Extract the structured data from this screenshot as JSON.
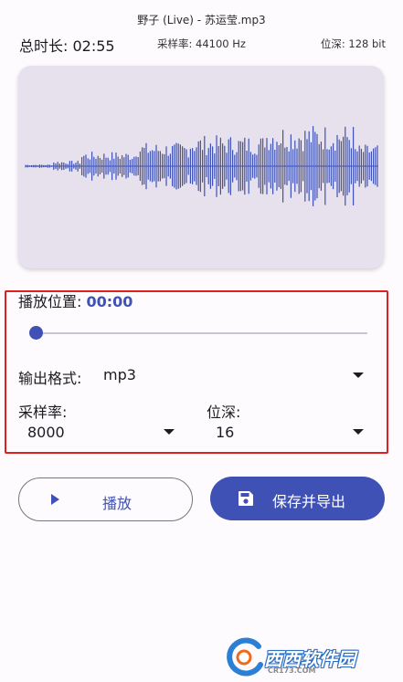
{
  "header": {
    "file_title": "野子 (Live) - 苏运莹.mp3",
    "duration": "总时长: 02:55",
    "sample_rate_info": "采样率: 44100 Hz",
    "bit_depth_info": "位深: 128 bit"
  },
  "waveform": {
    "color": "#3f51b5",
    "background": "#e6e1ec"
  },
  "controls": {
    "position_label": "播放位置: ",
    "position_value": "00:00",
    "playback_progress": 0,
    "output_format_label": "输出格式:",
    "output_format_value": "mp3",
    "sample_rate_label": "采样率:",
    "sample_rate_value": "8000",
    "bit_depth_label": "位深:",
    "bit_depth_value": "16"
  },
  "buttons": {
    "play_label": "播放",
    "export_label": "保存并导出"
  },
  "watermark": {
    "text": "西西软件园",
    "url": "CR173.COM"
  },
  "colors": {
    "accent": "#3f51b5",
    "highlight_border": "#e0201f"
  }
}
